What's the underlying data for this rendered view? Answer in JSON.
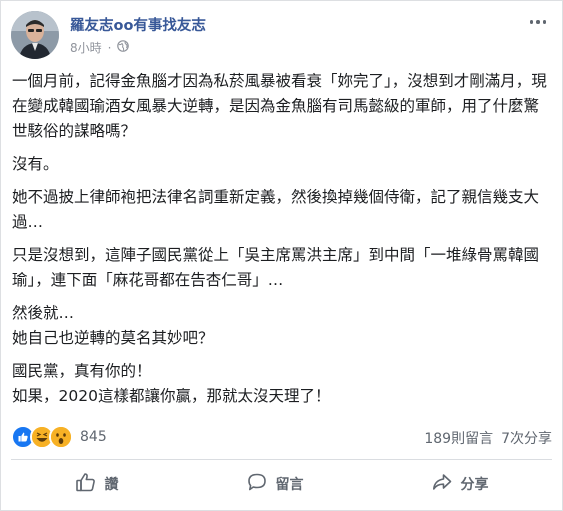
{
  "post": {
    "author": "羅友志oo有事找友志",
    "time": "8小時",
    "privacy_icon": "globe-icon",
    "paragraphs": [
      "一個月前，記得金魚腦才因為私菸風暴被看衰「妳完了」，沒想到才剛滿月，現在變成韓國瑜酒女風暴大逆轉，是因為金魚腦有司馬懿級的軍師，用了什麼驚世駭俗的謀略嗎？",
      "沒有。",
      "她不過披上律師袍把法律名詞重新定義，然後換掉幾個侍衛，記了親信幾支大過…",
      "只是沒想到，這陣子國民黨從上「吳主席罵洪主席」到中間「一堆綠骨罵韓國瑜」，連下面「麻花哥都在告杏仁哥」…",
      "然後就…\n她自己也逆轉的莫名其妙吧？",
      "國民黨，真有你的！\n如果，2020這樣都讓你贏，那就太沒天理了！"
    ]
  },
  "reactions": {
    "types": [
      "like-icon",
      "haha-icon",
      "wow-icon"
    ],
    "count": "845",
    "colors": {
      "like": "#1877f2",
      "reaction_yellow": "#f7b125"
    }
  },
  "stats": {
    "comments": "189則留言",
    "shares": "7次分享"
  },
  "actions": {
    "like": "讚",
    "comment": "留言",
    "share": "分享"
  },
  "colors": {
    "author_link": "#385898",
    "secondary_text": "#90949c",
    "action_text": "#606770"
  }
}
